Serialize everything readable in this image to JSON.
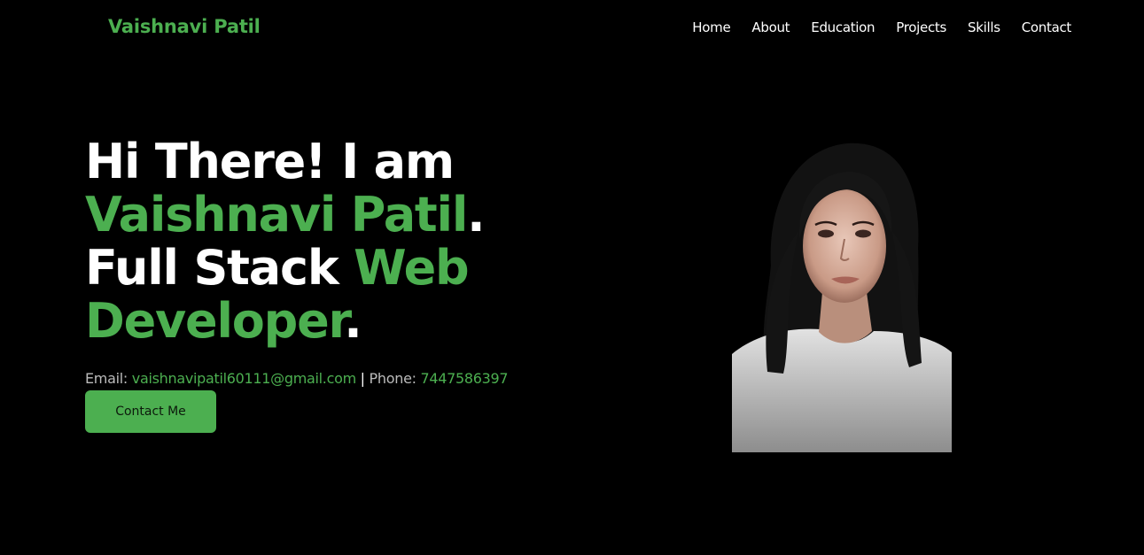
{
  "header": {
    "brand": "Vaishnavi Patil",
    "nav": [
      {
        "label": "Home"
      },
      {
        "label": "About"
      },
      {
        "label": "Education"
      },
      {
        "label": "Projects"
      },
      {
        "label": "Skills"
      },
      {
        "label": "Contact"
      }
    ]
  },
  "hero": {
    "greeting": "Hi There! I am",
    "name": "Vaishnavi Patil",
    "name_suffix": ".",
    "role_prefix": "Full Stack",
    "role_highlight_1": "Web",
    "role_highlight_2": "Developer",
    "role_suffix": ".",
    "email_label": "Email:",
    "email": "vaishnavipatil60111@gmail.com",
    "separator": "|",
    "phone_label": "Phone:",
    "phone": "7447586397",
    "cta_label": "Contact Me"
  },
  "colors": {
    "background": "#000000",
    "accent": "#4caf50",
    "text": "#ffffff"
  }
}
